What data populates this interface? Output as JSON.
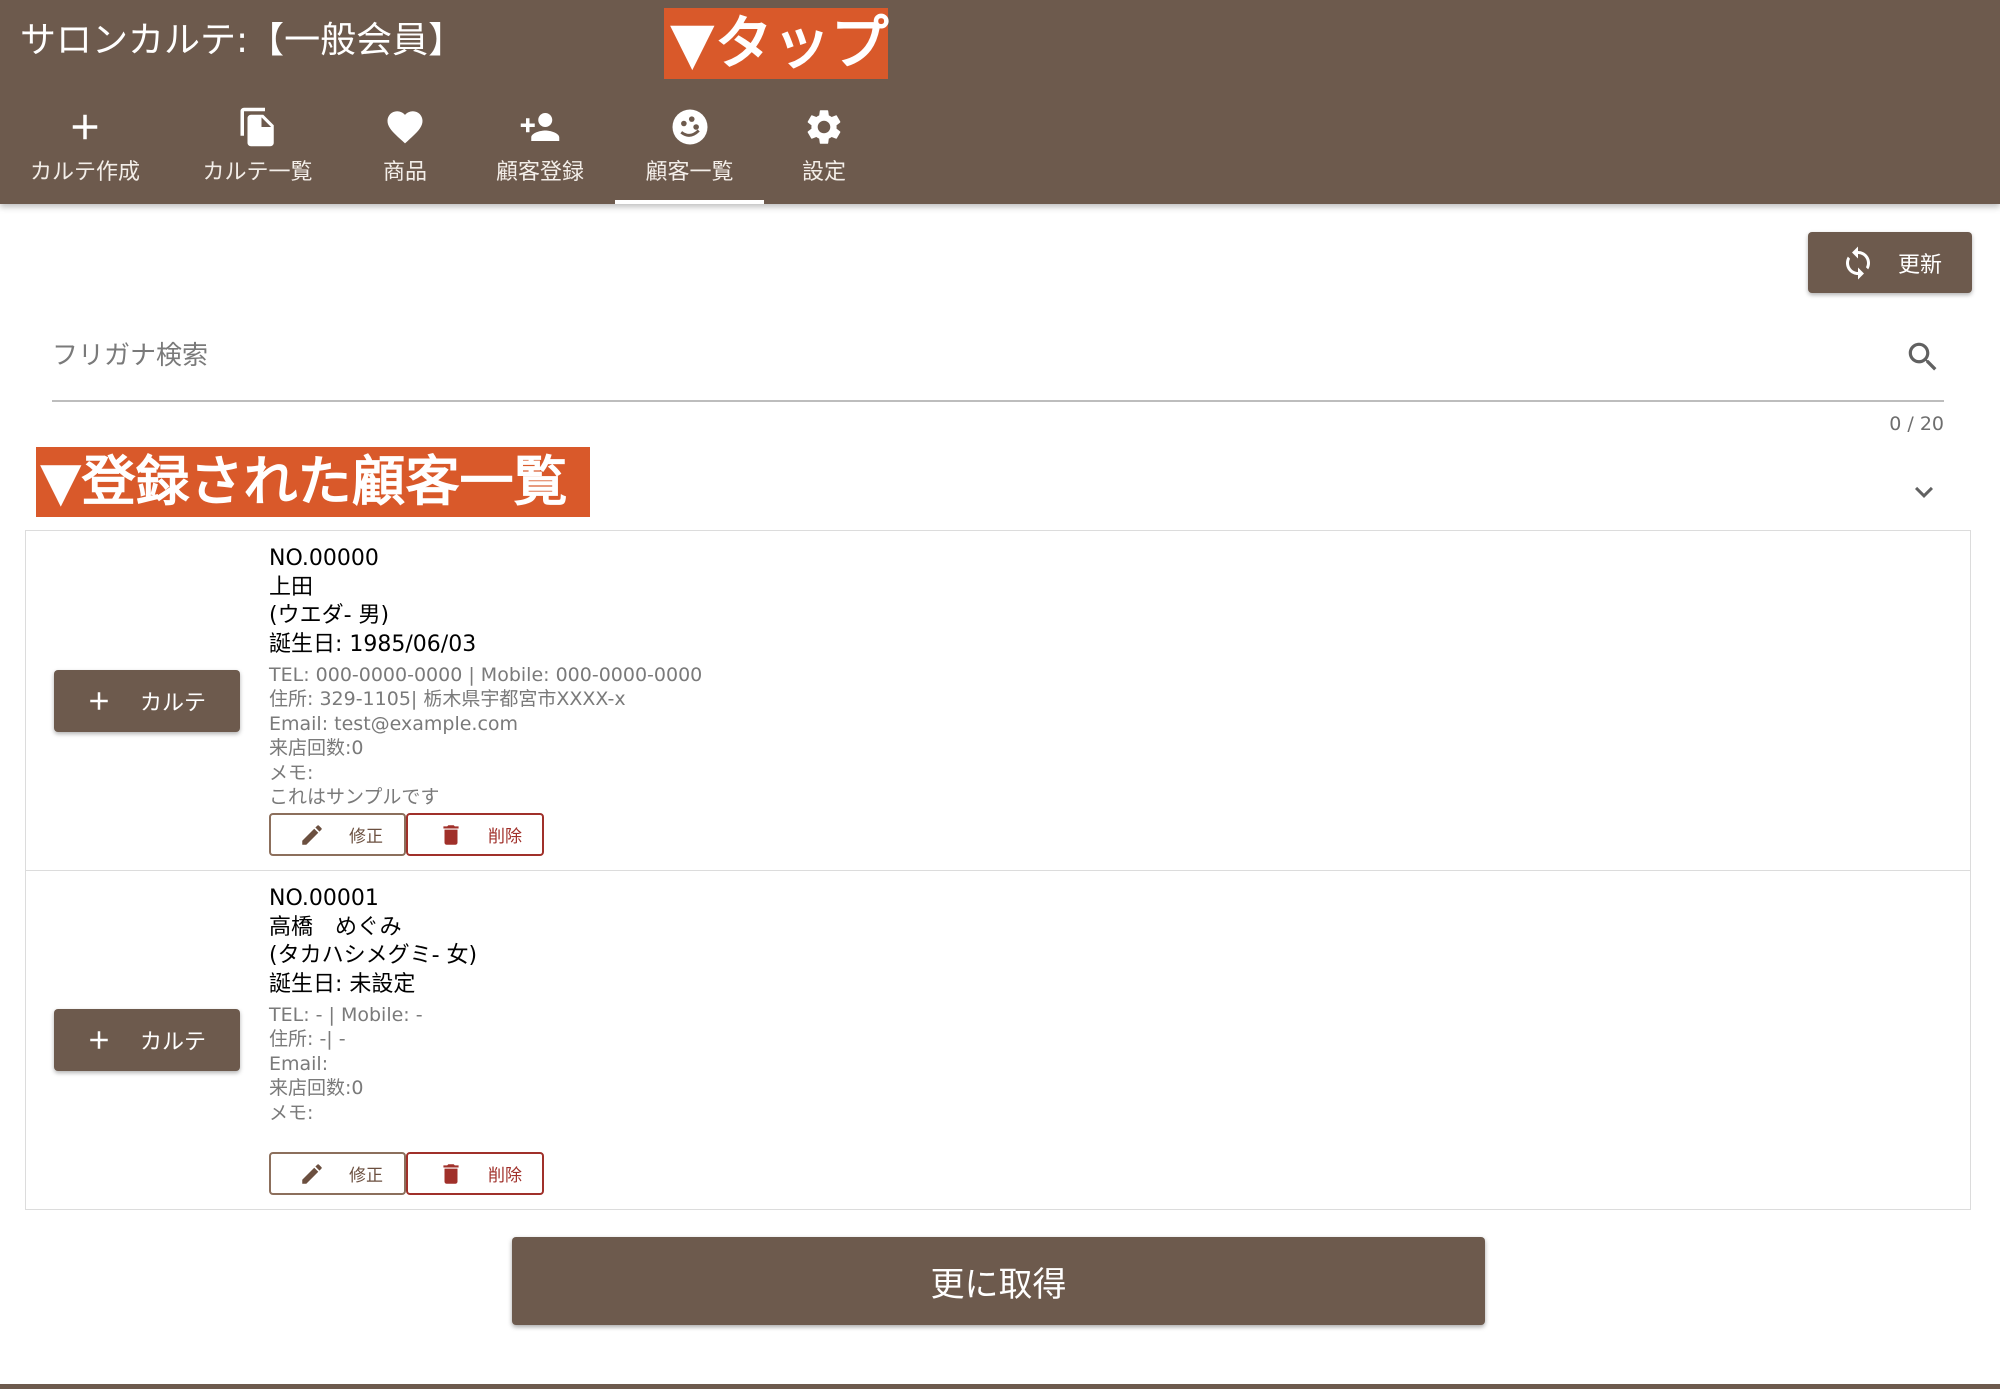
{
  "header": {
    "title": "サロンカルテ:【一般会員】",
    "annotation": "▼タップ",
    "tabs": [
      {
        "label": "カルテ作成",
        "icon": "plus-icon"
      },
      {
        "label": "カルテ一覧",
        "icon": "copy-icon"
      },
      {
        "label": "商品",
        "icon": "heart-icon"
      },
      {
        "label": "顧客登録",
        "icon": "person-add-icon"
      },
      {
        "label": "顧客一覧",
        "icon": "face-icon",
        "active": true
      },
      {
        "label": "設定",
        "icon": "gear-icon"
      }
    ]
  },
  "toolbar": {
    "refresh_label": "更新"
  },
  "search": {
    "placeholder": "フリガナ検索",
    "value": "",
    "counter": "0 / 20"
  },
  "list_annotation": "▼登録された顧客一覧",
  "customers": [
    {
      "no": "NO.00000",
      "name": "上田",
      "kana": "(ウエダ- 男)",
      "birthday": "誕生日: 1985/06/03",
      "tel": "TEL: 000-0000-0000 | Mobile: 000-0000-0000",
      "address": "住所: 329-1105| 栃木県宇都宮市XXXX-x",
      "email": "Email: test@example.com",
      "visits": "来店回数:0",
      "memo_label": "メモ:",
      "memo": "これはサンプルです"
    },
    {
      "no": "NO.00001",
      "name": "高橋　めぐみ",
      "kana": "(タカハシメグミ- 女)",
      "birthday": "誕生日: 未設定",
      "tel": "TEL: - | Mobile: -",
      "address": "住所: -| -",
      "email": "Email:",
      "visits": "来店回数:0",
      "memo_label": "メモ:",
      "memo": ""
    }
  ],
  "row_actions": {
    "karte_label": "カルテ",
    "edit_label": "修正",
    "delete_label": "削除"
  },
  "more_label": "更に取得",
  "colors": {
    "primary": "#6d5a4d",
    "annotation": "#d9592a",
    "danger": "#a0302a"
  }
}
